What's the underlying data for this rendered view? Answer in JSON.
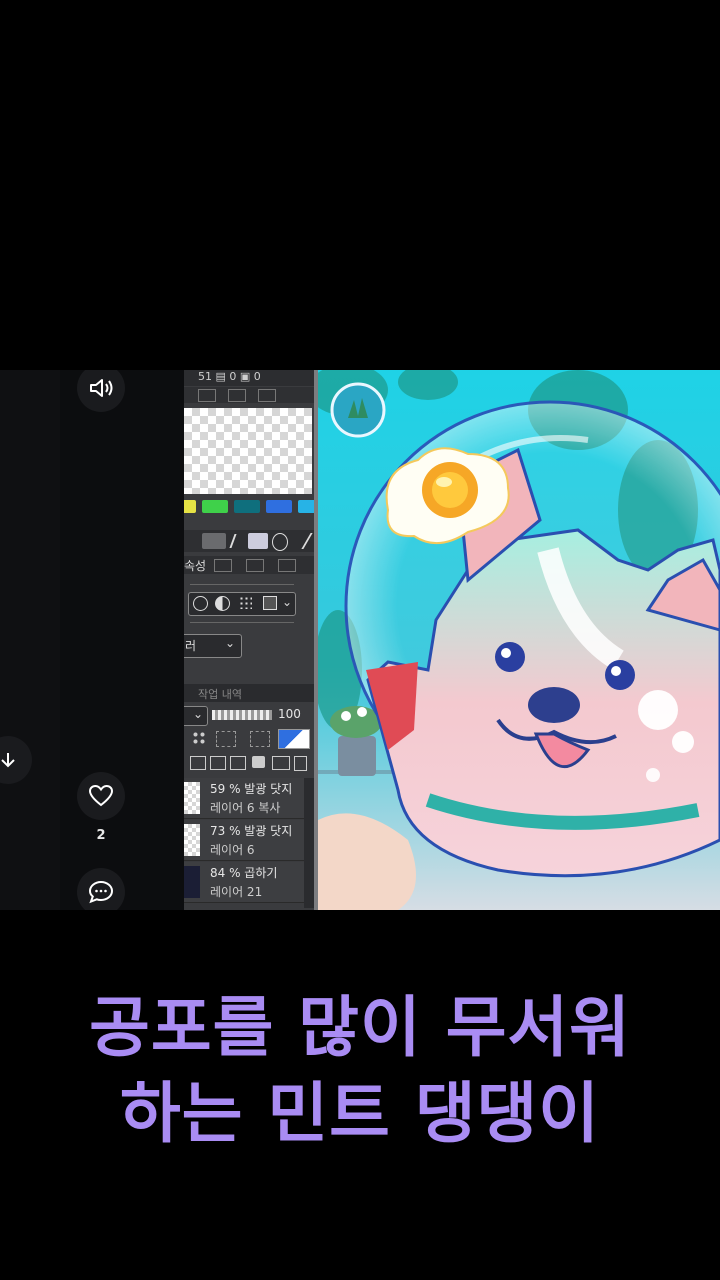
{
  "app_sidebar": {
    "like_count": "2",
    "icons": [
      "speaker-icon",
      "download-arrow-icon",
      "heart-icon",
      "comment-icon"
    ]
  },
  "paint_panel": {
    "topbar_text": "51 ▤  0 ▣  0",
    "property_tab": "속성",
    "blend_dropdown": "러",
    "history_tab": "작업 내역",
    "opacity_value": "100",
    "swatches": [
      "#e6e245",
      "#3fd14a",
      "#0f6f7d",
      "#2f6fe0",
      "#27b3e6"
    ],
    "layers": [
      {
        "line1": "59 % 발광 닷지",
        "line2": "레이어 6 복사"
      },
      {
        "line1": "73 % 발광 닷지",
        "line2": "레이어 6"
      },
      {
        "line1": "84 % 곱하기",
        "line2": "레이어 21"
      }
    ]
  },
  "caption": {
    "line1": "공포를 많이 무서워",
    "line2": "하는 민트 댕댕이",
    "color": "#a98cf3"
  }
}
